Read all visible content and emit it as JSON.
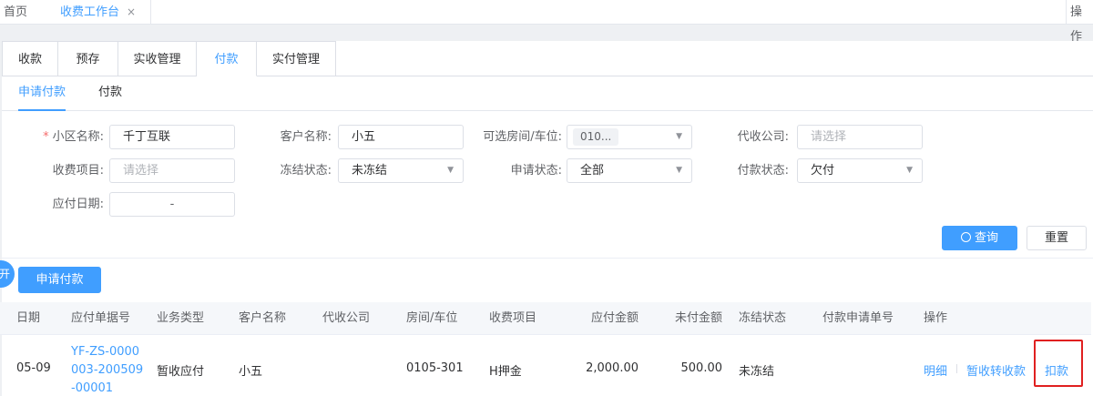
{
  "topbar": {
    "home": "首页",
    "active_tab": "收费工作台",
    "close_glyph": "×",
    "right": "操作"
  },
  "tabs": [
    {
      "label": "收款"
    },
    {
      "label": "预存"
    },
    {
      "label": "实收管理"
    },
    {
      "label": "付款"
    },
    {
      "label": "实付管理"
    }
  ],
  "subtabs": [
    {
      "label": "申请付款"
    },
    {
      "label": "付款"
    }
  ],
  "form": {
    "community": {
      "label": "小区名称:",
      "value": "千丁互联"
    },
    "customer": {
      "label": "客户名称:",
      "value": "小五"
    },
    "room": {
      "label": "可选房间/车位:",
      "value": "010..."
    },
    "agency": {
      "label": "代收公司:",
      "placeholder": "请选择"
    },
    "fee_item": {
      "label": "收费项目:",
      "placeholder": "请选择"
    },
    "freeze": {
      "label": "冻结状态:",
      "value": "未冻结"
    },
    "apply_status": {
      "label": "申请状态:",
      "value": "全部"
    },
    "pay_status": {
      "label": "付款状态:",
      "value": "欠付"
    },
    "due_date": {
      "label": "应付日期:",
      "value": "-"
    },
    "required_mark": "*"
  },
  "buttons": {
    "query": "查询",
    "reset": "重置",
    "apply": "申请付款"
  },
  "side_toggle": "开",
  "table": {
    "columns": [
      "日期",
      "应付单据号",
      "业务类型",
      "客户名称",
      "代收公司",
      "房间/车位",
      "收费项目",
      "应付金额",
      "未付金额",
      "冻结状态",
      "付款申请单号",
      "操作"
    ],
    "rows": [
      {
        "date": "05-09",
        "doc_no_lines": [
          "YF-ZS-0000",
          "003-200509",
          "-00001"
        ],
        "biz_type": "暂收应付",
        "customer": "小五",
        "agency": "",
        "room": "0105-301",
        "fee_item": "H押金",
        "due_amount": "2,000.00",
        "unpaid_amount": "500.00",
        "freeze": "未冻结",
        "apply_no": "",
        "actions": [
          "明细",
          "暂收转收款",
          "扣款"
        ]
      }
    ]
  },
  "colors": {
    "accent": "#409eff",
    "highlight": "#e02020"
  }
}
